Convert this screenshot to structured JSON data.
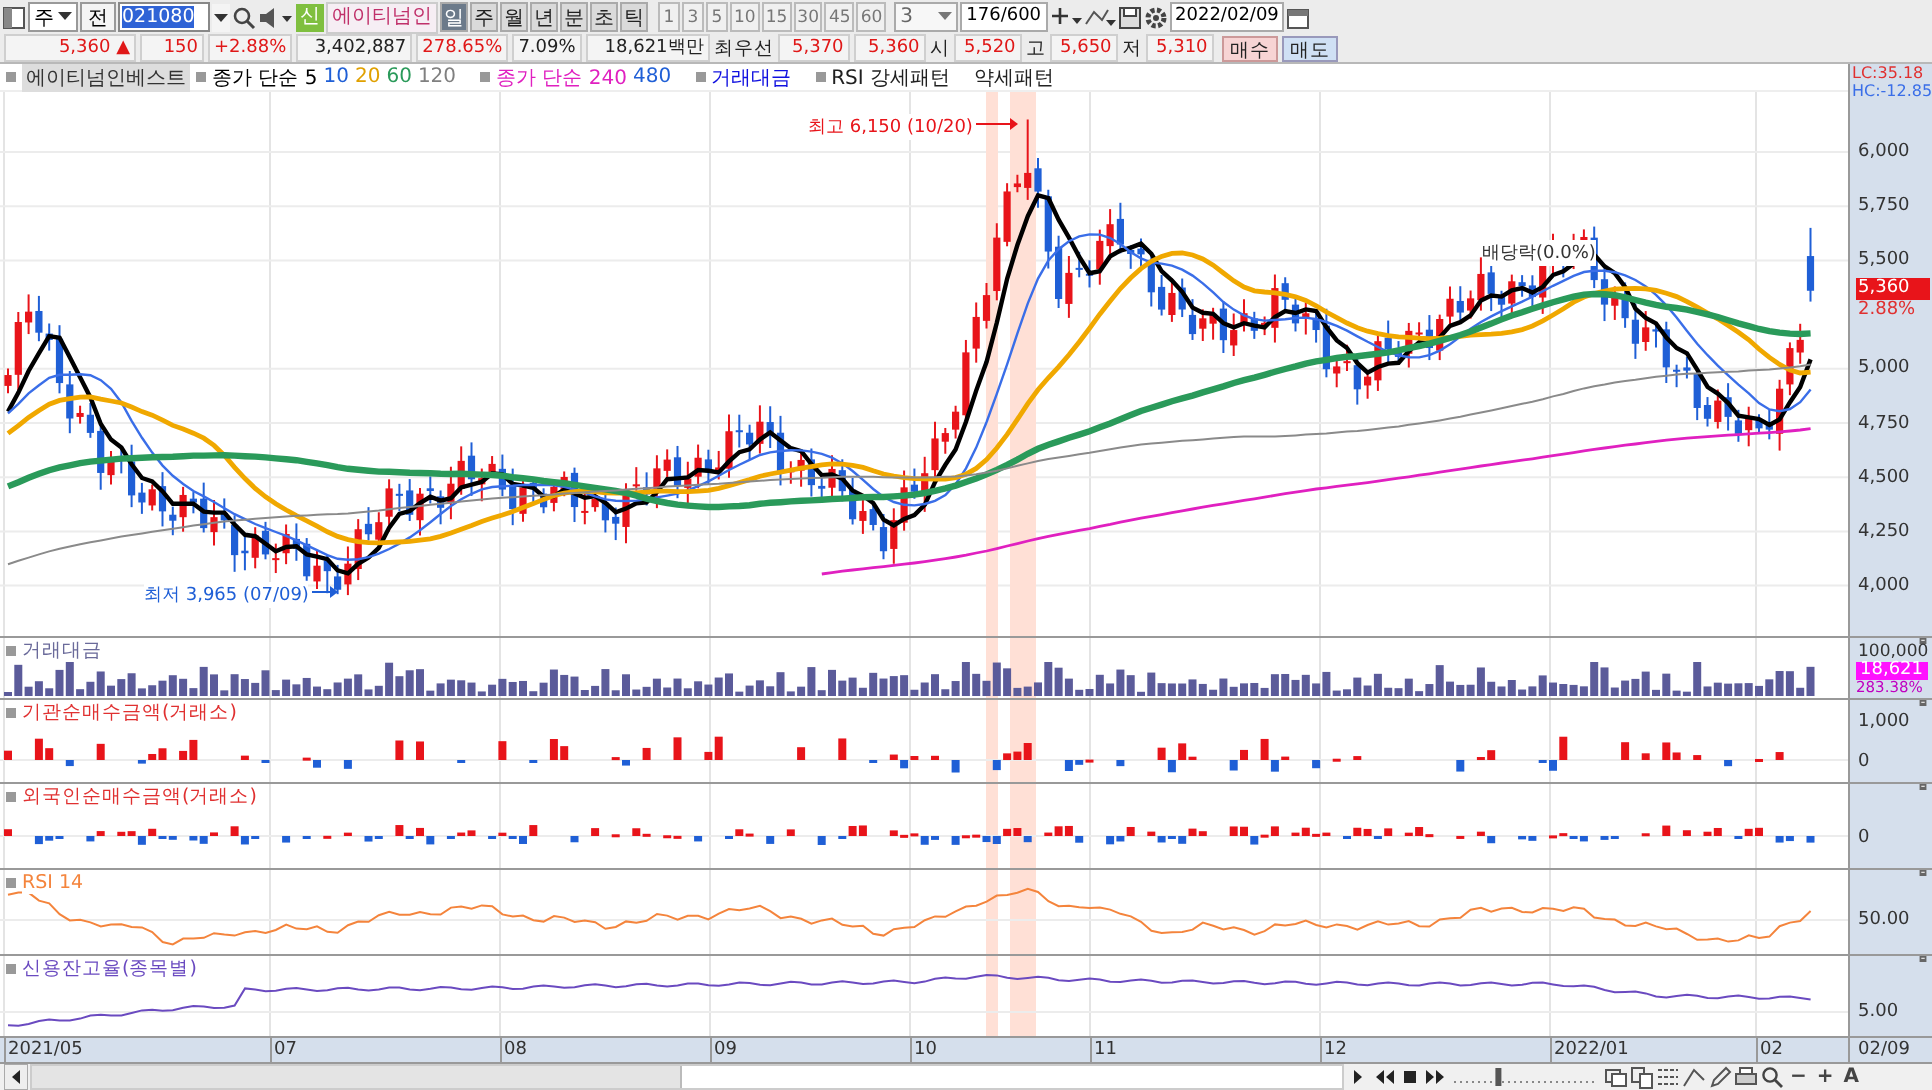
{
  "toolbar": {
    "market": "주",
    "type_label": "전",
    "code": "021080",
    "badge": "신",
    "stock_name": "에이티넘인",
    "periods": [
      {
        "label": "일",
        "selected": true
      },
      {
        "label": "주",
        "selected": false
      },
      {
        "label": "월",
        "selected": false
      },
      {
        "label": "년",
        "selected": false
      },
      {
        "label": "분",
        "selected": false
      },
      {
        "label": "초",
        "selected": false
      },
      {
        "label": "틱",
        "selected": false
      }
    ],
    "intervals": [
      "1",
      "3",
      "5",
      "10",
      "15",
      "30",
      "45",
      "60"
    ],
    "interval_value": "3",
    "count": "176/600",
    "date": "2022/02/09"
  },
  "quote": {
    "price": "5,360 ▲",
    "change": "150",
    "change_rate": "+2.88%",
    "volume": "3,402,887",
    "volume_rate": "278.65%",
    "turnover": "7.09%",
    "amount": "18,621백만",
    "best_label": "최우선",
    "ask": "5,370",
    "bid": "5,360",
    "open_label": "시",
    "open": "5,520",
    "high_label": "고",
    "high": "5,650",
    "low_label": "저",
    "low": "5,310",
    "buy": "매수",
    "sell": "매도"
  },
  "legend": [
    {
      "kind": "name",
      "text": "에이티넘인베스트"
    },
    {
      "kind": "series",
      "parts": [
        {
          "text": "종가 단순 5",
          "color": "#000000"
        },
        {
          "text": "10",
          "color": "#1f5fd6"
        },
        {
          "text": "20",
          "color": "#e0a000"
        },
        {
          "text": "60",
          "color": "#2a9a5a"
        },
        {
          "text": "120",
          "color": "#808080"
        }
      ]
    },
    {
      "kind": "series",
      "parts": [
        {
          "text": "종가 단순 240",
          "color": "#e020c0"
        },
        {
          "text": "480",
          "color": "#1f5fd6"
        }
      ]
    },
    {
      "kind": "series",
      "parts": [
        {
          "text": "거래대금",
          "color": "#1010e0"
        }
      ]
    },
    {
      "kind": "series",
      "parts": [
        {
          "text": "RSI 강세패턴",
          "color": "#202020"
        }
      ]
    },
    {
      "kind": "plain",
      "text": "약세패턴"
    }
  ],
  "main_chart": {
    "lc": "LC:35.18",
    "hc": "HC:-12.85",
    "high_note": "최고 6,150 (10/20)",
    "low_note": "최저 3,965 (07/09)",
    "event_note": "배당락(0.0%)",
    "price_ticks": [
      "6,000",
      "5,750",
      "5,500",
      "5,000",
      "4,750",
      "4,500",
      "4,250",
      "4,000"
    ],
    "current_price": "5,360",
    "current_rate": "2.88%"
  },
  "panels": [
    {
      "kind": "volume",
      "title": "거래대금",
      "ticks": [
        "100,000"
      ],
      "tag": "18,621",
      "tag_rate": "283.38%"
    },
    {
      "kind": "institution",
      "title": "기관순매수금액(거래소)",
      "ticks": [
        "1,000",
        "0"
      ]
    },
    {
      "kind": "foreign",
      "title": "외국인순매수금액(거래소)",
      "ticks": [
        "0"
      ]
    },
    {
      "kind": "rsi",
      "title": "RSI 14",
      "ticks": [
        "50.00"
      ]
    },
    {
      "kind": "credit",
      "title": "신용잔고율(종목별)",
      "ticks": [
        "5.00"
      ]
    }
  ],
  "date_axis": {
    "labels": [
      "2021/05",
      "07",
      "08",
      "09",
      "10",
      "11",
      "12",
      "2022/01",
      "02"
    ],
    "current": "02/09"
  },
  "zoom_slider": {
    "level": 0.3
  },
  "zoom_controls": [
    "−",
    "+",
    "A"
  ]
}
